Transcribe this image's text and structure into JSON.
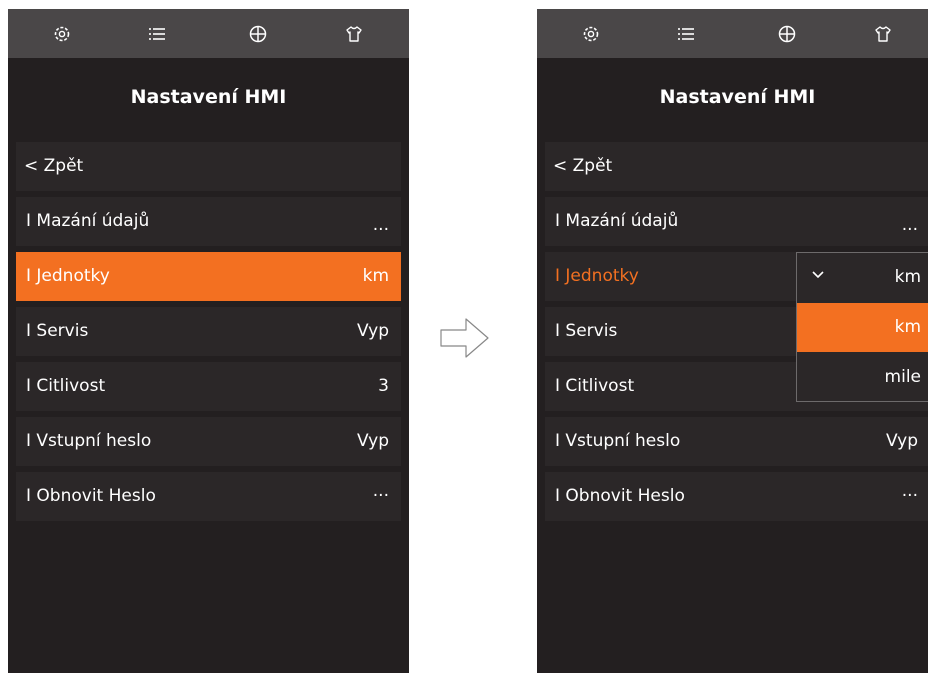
{
  "icons": [
    "gear-icon",
    "list-icon",
    "globe-icon",
    "shirt-icon"
  ],
  "colors": {
    "accent": "#f37021",
    "background": "#231f20",
    "topbar": "#4a4748",
    "row": "#2b2728"
  },
  "left": {
    "title": "Nastavení HMI",
    "back_label": "< Zpět",
    "items": [
      {
        "label": "I Mazání údajů",
        "value": "..."
      },
      {
        "label": "I Jednotky",
        "value": "km"
      },
      {
        "label": "I Servis",
        "value": "Vyp"
      },
      {
        "label": "I Citlivost",
        "value": "3"
      },
      {
        "label": "I Vstupní heslo",
        "value": "Vyp"
      },
      {
        "label": "I Obnovit Heslo",
        "value": "···"
      }
    ]
  },
  "right": {
    "title": "Nastavení HMI",
    "back_label": "< Zpět",
    "items": [
      {
        "label": "I Mazání údajů",
        "value": "..."
      },
      {
        "label": "I Jednotky",
        "value": ""
      },
      {
        "label": "I Servis",
        "value": ""
      },
      {
        "label": "I Citlivost",
        "value": ""
      },
      {
        "label": "I Vstupní heslo",
        "value": "Vyp"
      },
      {
        "label": "I Obnovit Heslo",
        "value": "···"
      }
    ],
    "dropdown": {
      "current": "km",
      "options": [
        "km",
        "mile"
      ],
      "selected": "km"
    }
  }
}
